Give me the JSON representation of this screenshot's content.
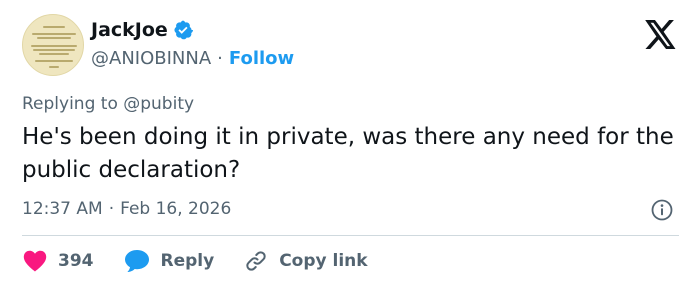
{
  "author": {
    "name": "JackJoe",
    "handle": "@ANIOBINNA",
    "separator": "·",
    "follow_label": "Follow",
    "avatar_icon": "profile-avatar",
    "verified_icon": "verified-badge-icon",
    "verified_color": "#1d9bf0"
  },
  "reply_to": "Replying to @pubity",
  "tweet": {
    "text": "He's been doing it in private, was there any need for the public declaration?",
    "time": "12:37 AM",
    "separator": "·",
    "date": "Feb 16, 2026"
  },
  "actions": {
    "like_count": "394",
    "reply_label": "Reply",
    "copy_label": "Copy link"
  },
  "colors": {
    "text": "#0f1419",
    "secondary": "#536471",
    "accent": "#1d9bf0",
    "like": "#f91880",
    "divider": "#cfd9de"
  },
  "icons": [
    "x-logo-icon",
    "info-icon",
    "heart-icon",
    "reply-bubble-icon",
    "link-icon"
  ]
}
